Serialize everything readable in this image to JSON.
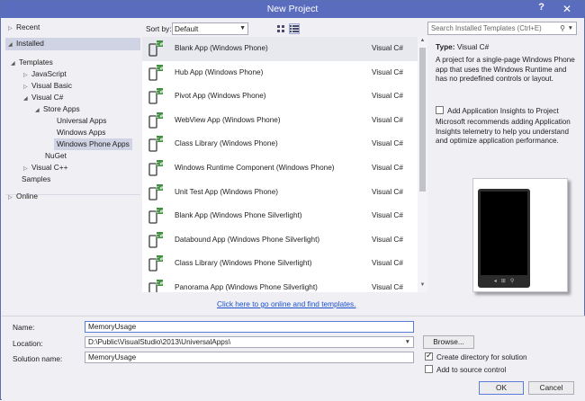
{
  "window": {
    "title": "New Project",
    "help": "?",
    "close": "✕"
  },
  "tree": {
    "recent": "Recent",
    "installed": "Installed",
    "templates": "Templates",
    "javascript": "JavaScript",
    "visual_basic": "Visual Basic",
    "visual_csharp": "Visual C#",
    "store_apps": "Store Apps",
    "universal_apps": "Universal Apps",
    "windows_apps": "Windows Apps",
    "windows_phone_apps": "Windows Phone Apps",
    "nuget": "NuGet",
    "visual_cpp": "Visual C++",
    "samples": "Samples",
    "online": "Online"
  },
  "sort": {
    "label": "Sort by:",
    "value": "Default"
  },
  "templates": [
    {
      "name": "Blank App (Windows Phone)",
      "lang": "Visual C#"
    },
    {
      "name": "Hub App (Windows Phone)",
      "lang": "Visual C#"
    },
    {
      "name": "Pivot App (Windows Phone)",
      "lang": "Visual C#"
    },
    {
      "name": "WebView App (Windows Phone)",
      "lang": "Visual C#"
    },
    {
      "name": "Class Library (Windows Phone)",
      "lang": "Visual C#"
    },
    {
      "name": "Windows Runtime Component (Windows Phone)",
      "lang": "Visual C#"
    },
    {
      "name": "Unit Test App (Windows Phone)",
      "lang": "Visual C#"
    },
    {
      "name": "Blank App (Windows Phone Silverlight)",
      "lang": "Visual C#"
    },
    {
      "name": "Databound App (Windows Phone Silverlight)",
      "lang": "Visual C#"
    },
    {
      "name": "Class Library (Windows Phone Silverlight)",
      "lang": "Visual C#"
    },
    {
      "name": "Panorama App (Windows Phone Silverlight)",
      "lang": "Visual C#"
    }
  ],
  "online_link": "Click here to go online and find templates.",
  "search": {
    "placeholder": "Search Installed Templates (Ctrl+E)"
  },
  "details": {
    "type_label": "Type:",
    "type_value": "Visual C#",
    "description": "A project for a single-page Windows Phone app that uses the Windows Runtime and has no predefined controls or layout.",
    "insights_label": "Add Application Insights to Project",
    "insights_desc": "Microsoft recommends adding Application Insights telemetry to help you understand and optimize application performance."
  },
  "form": {
    "name_label": "Name:",
    "name_value": "MemoryUsage",
    "location_label": "Location:",
    "location_value": "D:\\Public\\VisualStudio\\2013\\UniversalApps\\",
    "solution_label": "Solution name:",
    "solution_value": "MemoryUsage",
    "browse": "Browse...",
    "create_dir": "Create directory for solution",
    "source_control": "Add to source control",
    "ok": "OK",
    "cancel": "Cancel"
  },
  "colors": {
    "titlebar": "#5a6cbd",
    "selection": "#cfd3e4",
    "link": "#1a4fd0"
  }
}
